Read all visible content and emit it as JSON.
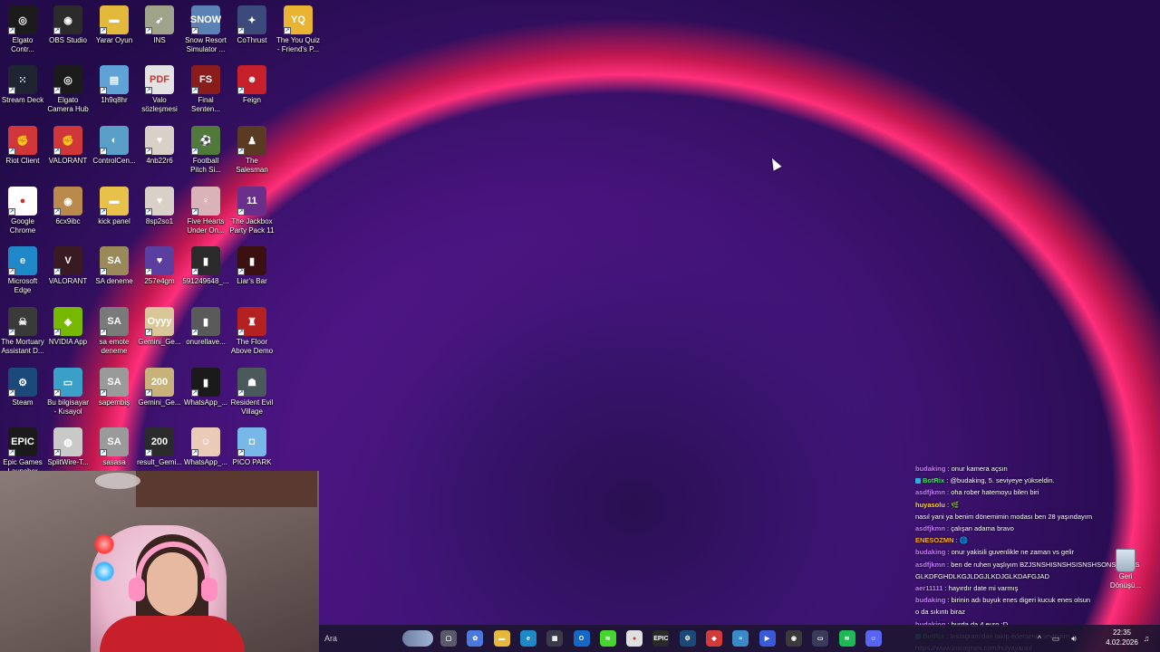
{
  "desktop": {
    "icons": [
      {
        "label": "Elgato\nContr...",
        "color": "#1b1b1b",
        "glyph": "◎"
      },
      {
        "label": "OBS Studio",
        "color": "#2b2b2b",
        "glyph": "◉"
      },
      {
        "label": "Yarar Oyun",
        "color": "#e2b93b",
        "glyph": "▬"
      },
      {
        "label": "INS",
        "color": "#9ea38a",
        "glyph": "➶"
      },
      {
        "label": "Snow Resort\nSimulator ...",
        "color": "#5b82b5",
        "glyph": "SNOW"
      },
      {
        "label": "CoThrust",
        "color": "#3b4a7a",
        "glyph": "✦"
      },
      {
        "label": "The You Quiz\n- Friend's P...",
        "color": "#e8b432",
        "glyph": "YQ"
      },
      {
        "label": "Stream Deck",
        "color": "#1f2433",
        "glyph": "⁙"
      },
      {
        "label": "Elgato\nCamera Hub",
        "color": "#1b1b1b",
        "glyph": "◎"
      },
      {
        "label": "1h9q8hr",
        "color": "#5ea2d6",
        "glyph": "▤"
      },
      {
        "label": "Valo\nsözleşmesi",
        "color": "#e3e3e3",
        "glyph": "PDF"
      },
      {
        "label": "Final\nSenten...",
        "color": "#8a1c1c",
        "glyph": "FS"
      },
      {
        "label": "Feign",
        "color": "#c8202a",
        "glyph": "☻"
      },
      {
        "label": "Riot Client",
        "color": "#d1363a",
        "glyph": "✊"
      },
      {
        "label": "VALORANT",
        "color": "#d1363a",
        "glyph": "✊"
      },
      {
        "label": "ControlCen...",
        "color": "#5a9fc7",
        "glyph": "◐"
      },
      {
        "label": "4nb22r6",
        "color": "#d9d0c8",
        "glyph": "♥"
      },
      {
        "label": "Football\nPitch Si...",
        "color": "#4f7a3a",
        "glyph": "⚽"
      },
      {
        "label": "The\nSalesman",
        "color": "#5a3a22",
        "glyph": "♟"
      },
      {
        "label": "Google\nChrome",
        "color": "#ffffff",
        "glyph": "●"
      },
      {
        "label": "6cx9ibc",
        "color": "#b98a4c",
        "glyph": "◉"
      },
      {
        "label": "kick panel",
        "color": "#e8c14a",
        "glyph": "▬"
      },
      {
        "label": "8sp2so1",
        "color": "#d9d0c8",
        "glyph": "♥"
      },
      {
        "label": "Five Hearts\nUnder On...",
        "color": "#d9b3b8",
        "glyph": "♀"
      },
      {
        "label": "The Jackbox\nParty Pack 11",
        "color": "#6a2f8a",
        "glyph": "11"
      },
      {
        "label": "Microsoft\nEdge",
        "color": "#1e88c8",
        "glyph": "e"
      },
      {
        "label": "VALORANT",
        "color": "#3a1a22",
        "glyph": "V"
      },
      {
        "label": "SA deneme",
        "color": "#9a8a5a",
        "glyph": "SA"
      },
      {
        "label": "257e4gm",
        "color": "#5a3fa0",
        "glyph": "♥"
      },
      {
        "label": "591249648_...",
        "color": "#2a2a2a",
        "glyph": "▮"
      },
      {
        "label": "Liar's Bar",
        "color": "#3a1010",
        "glyph": "▮"
      },
      {
        "label": "The Mortuary\nAssistant D...",
        "color": "#3a3a3a",
        "glyph": "☠"
      },
      {
        "label": "NVIDIA App",
        "color": "#76b900",
        "glyph": "◈"
      },
      {
        "label": "sa emote\ndeneme",
        "color": "#7a7a7a",
        "glyph": "SA"
      },
      {
        "label": "Gemini_Ge...",
        "color": "#d9c79a",
        "glyph": "Oyyy"
      },
      {
        "label": "onurellave...",
        "color": "#5a5a5a",
        "glyph": "▮"
      },
      {
        "label": "The Floor\nAbove Demo",
        "color": "#b52020",
        "glyph": "♜"
      },
      {
        "label": "Steam",
        "color": "#1b4a7a",
        "glyph": "⚙"
      },
      {
        "label": "Bu bilgisayar\n- Kısayol",
        "color": "#3aa0c8",
        "glyph": "▭"
      },
      {
        "label": "sapembiş",
        "color": "#9a9a9a",
        "glyph": "SA"
      },
      {
        "label": "Gemini_Ge...",
        "color": "#c9b27a",
        "glyph": "200"
      },
      {
        "label": "WhatsApp_...",
        "color": "#1a1a1a",
        "glyph": "▮"
      },
      {
        "label": "Resident Evil\nVillage",
        "color": "#4a5a5a",
        "glyph": "☗"
      },
      {
        "label": "Epic Games\nLauncher",
        "color": "#1a1a1a",
        "glyph": "EPIC"
      },
      {
        "label": "SplitWire-T...",
        "color": "#c9c9c9",
        "glyph": "◍"
      },
      {
        "label": "sasasa",
        "color": "#9a9a9a",
        "glyph": "SA"
      },
      {
        "label": "result_Gemi...",
        "color": "#2a2a2a",
        "glyph": "200"
      },
      {
        "label": "WhatsApp_...",
        "color": "#e9cbb8",
        "glyph": "☺"
      },
      {
        "label": "PICO PARK",
        "color": "#78b8e8",
        "glyph": "◘"
      }
    ]
  },
  "chat": {
    "messages": [
      {
        "user": "budaking",
        "user_color": "#c77dff",
        "text": "onur kamera açsın",
        "badge": false
      },
      {
        "user": "BotRix",
        "user_color": "#39e75f",
        "text": "@budaking, 5. seviyeye yükseldin.",
        "badge": true
      },
      {
        "user": "asdfjkmn",
        "user_color": "#c77dff",
        "text": "oha rober hatemoyu bilen biri",
        "badge": false
      },
      {
        "user": "huyasolu",
        "user_color": "#ffd24a",
        "text": "🌿",
        "badge": false
      },
      {
        "user": "",
        "user_color": "#c0303a",
        "text": "nasıl yani ya benim dönemimin modası ben 28 yaşındayım",
        "badge": false
      },
      {
        "user": "asdfjkmn",
        "user_color": "#c77dff",
        "text": "çalışan adama bravo",
        "badge": false
      },
      {
        "user": "ENESOZMN",
        "user_color": "#ffb020",
        "text": "🌐",
        "badge": false
      },
      {
        "user": "budaking",
        "user_color": "#c77dff",
        "text": "onur yakisili guvenlikle ne zaman vs gelir",
        "badge": false
      },
      {
        "user": "asdfjkmn",
        "user_color": "#c77dff",
        "text": "ben de ruhen yaşlıyım BZJSNSHISNSHSISNSHSONSHSOKS",
        "badge": false
      },
      {
        "user": "",
        "user_color": "#c0303a",
        "text": "GLKDFGHDLKGJLDGJLKDJGLKDAFGJAD",
        "badge": false
      },
      {
        "user": "aer11111",
        "user_color": "#c77dff",
        "text": "hayırdır date mi varmış",
        "badge": false
      },
      {
        "user": "budaking",
        "user_color": "#c77dff",
        "text": "birinin adı buyuk enes digeri kucuk enes olsun",
        "badge": false
      },
      {
        "user": "",
        "user_color": "#c0303a",
        "text": "o da sıkıntı biraz",
        "badge": false
      },
      {
        "user": "budaking",
        "user_color": "#c77dff",
        "text": "burda da 4 euro ;D",
        "badge": false
      },
      {
        "user": "BotRix",
        "user_color": "#39e75f",
        "text": "Instagram'dan takip ederseniz sevinirim",
        "badge": true
      },
      {
        "user": "",
        "user_color": "#ffffff",
        "text": "https://www.instagram.com/hulyayarar/",
        "badge": false
      }
    ]
  },
  "recycle_bin": {
    "label": "Geri\nDönüşü..."
  },
  "taskbar": {
    "search_placeholder": "Ara",
    "apps": [
      {
        "name": "task-view",
        "color": "#5a5a6a",
        "glyph": "▢"
      },
      {
        "name": "copilot",
        "color": "#4a7ae0",
        "glyph": "✿"
      },
      {
        "name": "file-explorer",
        "color": "#e8b83a",
        "glyph": "▬"
      },
      {
        "name": "edge",
        "color": "#1e88c8",
        "glyph": "e"
      },
      {
        "name": "store",
        "color": "#3a3a4a",
        "glyph": "▦"
      },
      {
        "name": "outlook",
        "color": "#1468c8",
        "glyph": "O"
      },
      {
        "name": "razer",
        "color": "#44d62c",
        "glyph": "≋"
      },
      {
        "name": "chrome",
        "color": "#e0e0e0",
        "glyph": "●"
      },
      {
        "name": "epic-games",
        "color": "#2a2a2a",
        "glyph": "EPIC"
      },
      {
        "name": "steam",
        "color": "#1b4a7a",
        "glyph": "⚙"
      },
      {
        "name": "anydesk",
        "color": "#d33a3a",
        "glyph": "◆"
      },
      {
        "name": "wing-app",
        "color": "#3a8ac8",
        "glyph": "≈"
      },
      {
        "name": "video-app",
        "color": "#3a5ad8",
        "glyph": "▶"
      },
      {
        "name": "obs",
        "color": "#3a3a3a",
        "glyph": "◉"
      },
      {
        "name": "discord-alt",
        "color": "#3a3a5a",
        "glyph": "▭"
      },
      {
        "name": "spotify",
        "color": "#1db954",
        "glyph": "≋"
      },
      {
        "name": "discord",
        "color": "#5865f2",
        "glyph": "☺"
      }
    ],
    "time": "22:35",
    "date": "4.02.2026"
  }
}
